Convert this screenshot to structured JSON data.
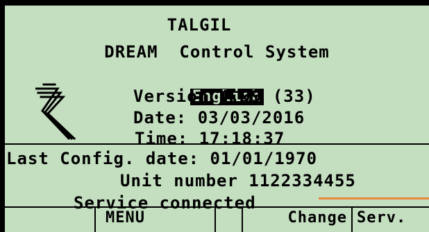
{
  "screen": {
    "title": "TALGIL",
    "subtitle": "DREAM  Control System",
    "language": "English",
    "version": "Version 4.99 (33)",
    "date": "Date: 03/03/2016",
    "time": "Time: 17:18:37",
    "last_config": "Last Config. date: 01/01/1970",
    "unit_number": "Unit number 1122334455",
    "service_status": "Service connected"
  },
  "softkeys": {
    "key1": "",
    "key2": "MENU",
    "key3": "",
    "key4": "Change",
    "key5": "Serv."
  },
  "colors": {
    "lcd_background": "#c4dec0",
    "text": "#000000",
    "highlight_line": "#e88a3c"
  },
  "icons": {
    "logo": "talgil-logo-icon"
  }
}
